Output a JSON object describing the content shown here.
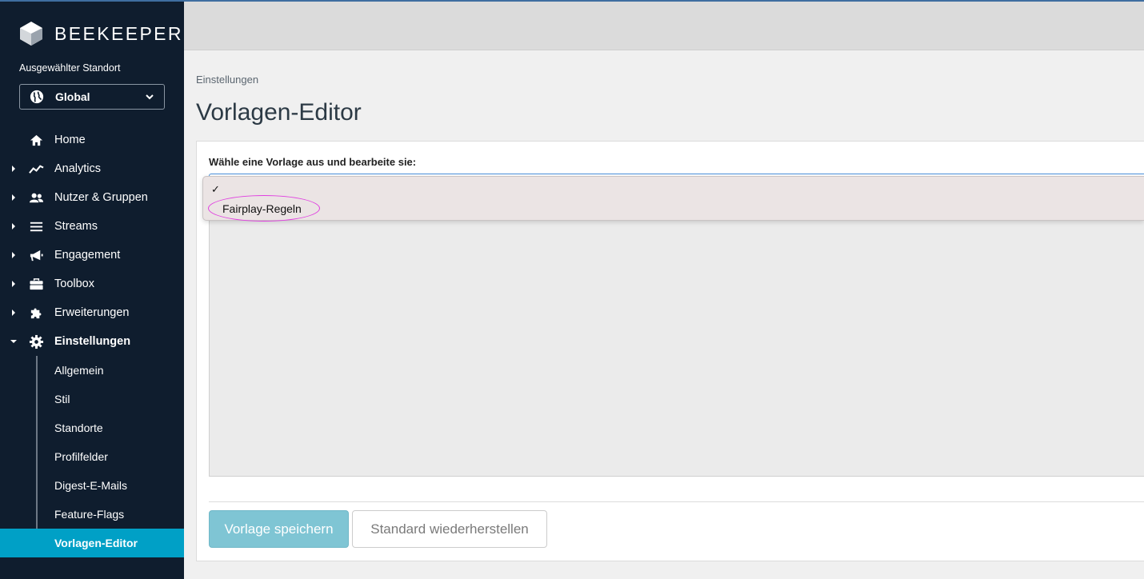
{
  "app": {
    "brand": "BEEKEEPER",
    "accent": "#00a0c6",
    "sidebar_bg": "#0f1d2e"
  },
  "location": {
    "label": "Ausgewählter Standort",
    "value": "Global"
  },
  "nav": {
    "items": [
      {
        "label": "Home",
        "icon": "home-icon",
        "expandable": false
      },
      {
        "label": "Analytics",
        "icon": "analytics-icon",
        "expandable": true
      },
      {
        "label": "Nutzer & Gruppen",
        "icon": "users-icon",
        "expandable": true
      },
      {
        "label": "Streams",
        "icon": "list-icon",
        "expandable": true
      },
      {
        "label": "Engagement",
        "icon": "megaphone-icon",
        "expandable": true
      },
      {
        "label": "Toolbox",
        "icon": "toolbox-icon",
        "expandable": true
      },
      {
        "label": "Erweiterungen",
        "icon": "puzzle-icon",
        "expandable": true
      },
      {
        "label": "Einstellungen",
        "icon": "gear-icon",
        "expandable": true,
        "expanded": true
      }
    ],
    "sub_items": [
      {
        "label": "Allgemein"
      },
      {
        "label": "Stil"
      },
      {
        "label": "Standorte"
      },
      {
        "label": "Profilfelder"
      },
      {
        "label": "Digest-E-Mails"
      },
      {
        "label": "Feature-Flags"
      },
      {
        "label": "Vorlagen-Editor",
        "active": true
      }
    ]
  },
  "main": {
    "breadcrumb": "Einstellungen",
    "title": "Vorlagen-Editor",
    "field_label": "Wähle eine Vorlage aus und bearbeite sie:",
    "dropdown": {
      "checkmark": "✓",
      "options": [
        "Fairplay-Regeln"
      ]
    },
    "save_label": "Vorlage speichern",
    "reset_label": "Standard wiederherstellen"
  }
}
